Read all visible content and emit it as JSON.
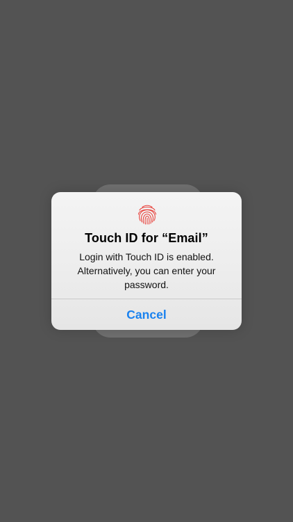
{
  "alert": {
    "icon": "fingerprint-icon",
    "title": "Touch ID for “Email”",
    "message_lines": [
      "Login with Touch ID is enabled.",
      "Alternatively, you can enter your",
      "password."
    ],
    "cancel_label": "Cancel"
  },
  "colors": {
    "background": "#535353",
    "accent": "#1a82ef",
    "fingerprint": "#e8413b"
  }
}
